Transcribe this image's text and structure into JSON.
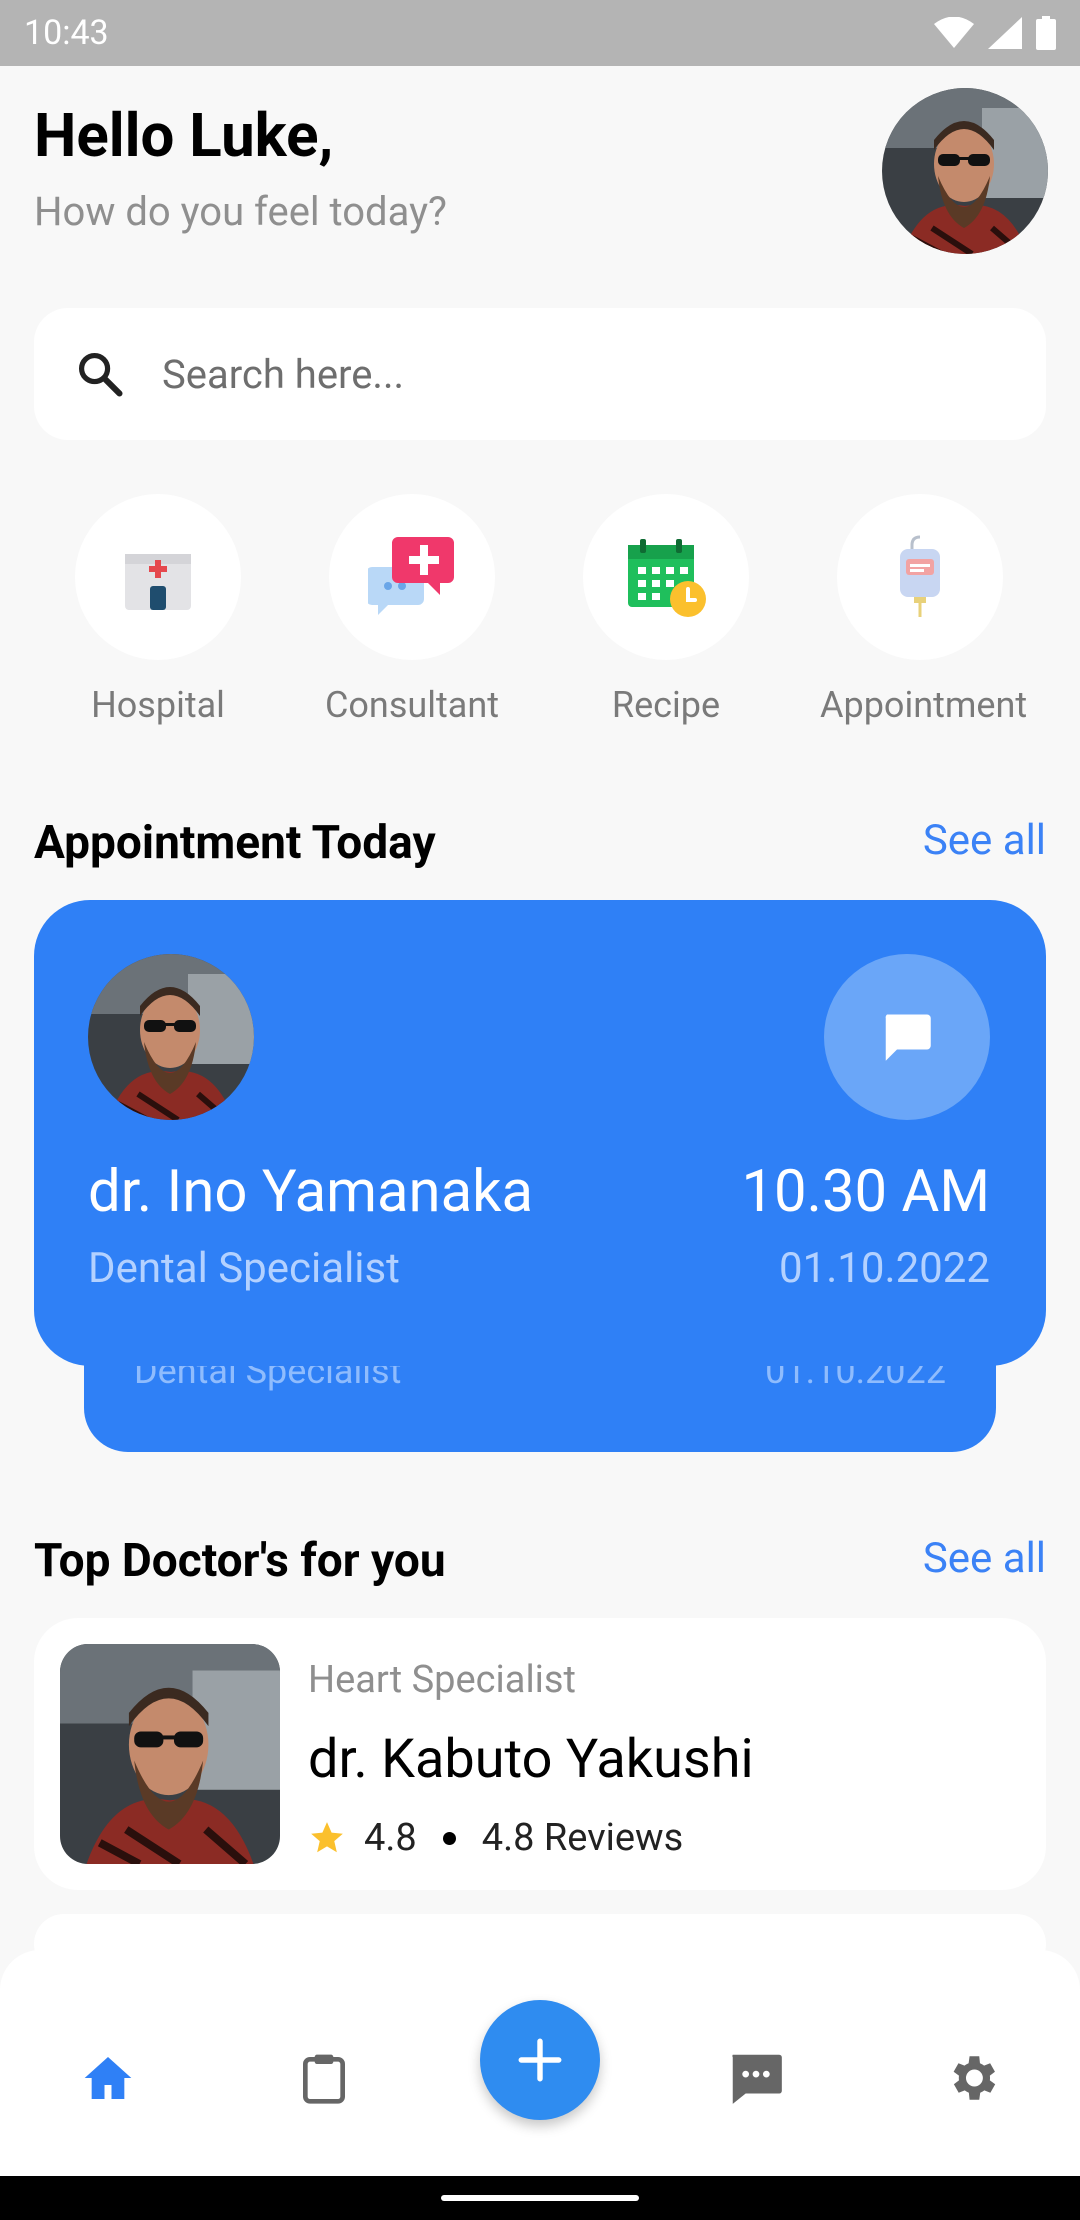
{
  "status_bar": {
    "time": "10:43"
  },
  "header": {
    "greeting": "Hello Luke,",
    "subtitle": "How do you feel today?"
  },
  "search": {
    "placeholder": "Search here..."
  },
  "categories": [
    {
      "label": "Hospital",
      "icon": "hospital-icon"
    },
    {
      "label": "Consultant",
      "icon": "consultant-chat-icon"
    },
    {
      "label": "Recipe",
      "icon": "calendar-clock-icon"
    },
    {
      "label": "Appointment",
      "icon": "iv-bag-icon"
    }
  ],
  "appointment_section": {
    "title": "Appointment Today",
    "see_all": "See all",
    "card": {
      "doctor_name": "dr. Ino Yamanaka",
      "specialty": "Dental Specialist",
      "time": "10.30 AM",
      "date": "01.10.2022"
    },
    "back_card": {
      "specialty": "Dental Specialist",
      "date": "01.10.2022"
    }
  },
  "top_doctors_section": {
    "title": "Top Doctor's for you",
    "see_all": "See all",
    "doctors": [
      {
        "specialty": "Heart Specialist",
        "name": "dr. Kabuto Yakushi",
        "rating": "4.8",
        "reviews": "4.8 Reviews"
      }
    ]
  },
  "bottom_nav": {
    "items": [
      "home-icon",
      "clipboard-icon",
      "add-icon",
      "message-icon",
      "settings-icon"
    ],
    "active": "home-icon"
  },
  "colors": {
    "accent": "#2F80F6",
    "link": "#3B82F6",
    "background": "#F8F8F8",
    "status_bar": "#B4B4B4",
    "star": "#FBC02D"
  }
}
